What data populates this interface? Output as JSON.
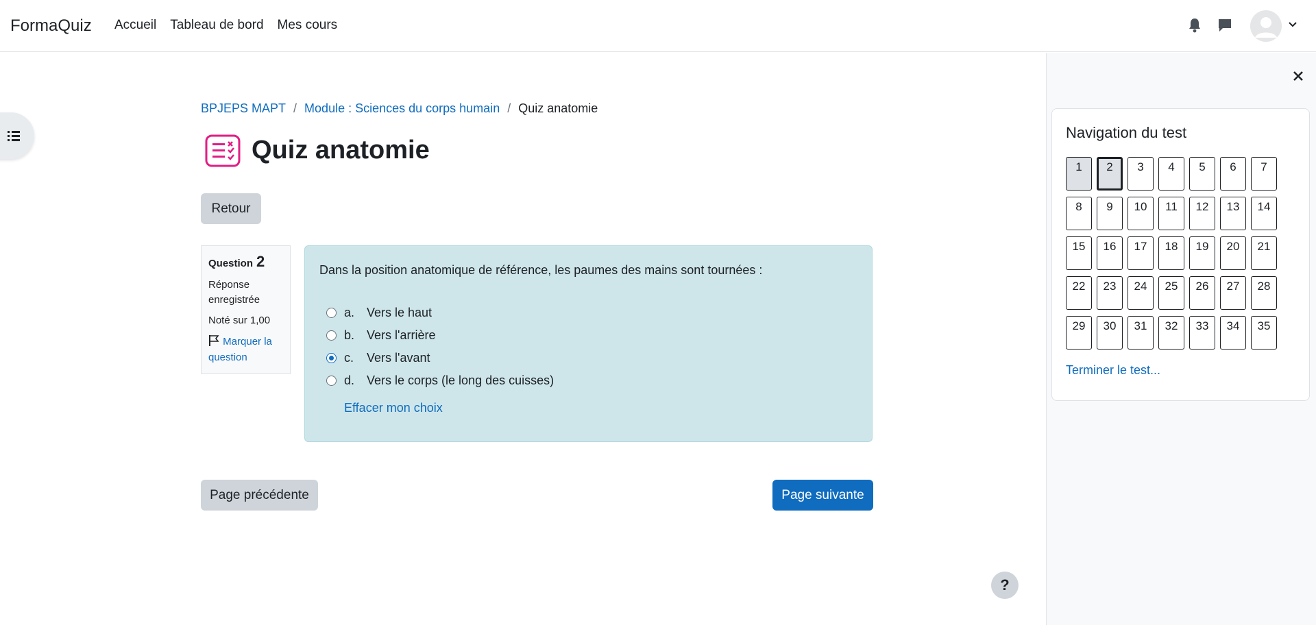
{
  "navbar": {
    "brand": "FormaQuiz",
    "links": [
      "Accueil",
      "Tableau de bord",
      "Mes cours"
    ],
    "icons": [
      "bell-icon",
      "chat-icon",
      "avatar",
      "chevron-down-icon"
    ]
  },
  "breadcrumb": {
    "items": [
      "BPJEPS MAPT",
      "Module : Sciences du corps humain"
    ],
    "current": "Quiz anatomie",
    "separator": "/"
  },
  "page": {
    "title": "Quiz anatomie",
    "back_label": "Retour",
    "prev_label": "Page précédente",
    "next_label": "Page suivante",
    "help_label": "?"
  },
  "question_info": {
    "label": "Question",
    "number": "2",
    "state": "Réponse enregistrée",
    "grade": "Noté sur 1,00",
    "flag_label": "Marquer la question"
  },
  "question": {
    "text": "Dans la position anatomique de référence, les paumes des mains sont tournées :",
    "answers": [
      {
        "letter": "a.",
        "text": "Vers le haut",
        "checked": false
      },
      {
        "letter": "b.",
        "text": "Vers l'arrière",
        "checked": false
      },
      {
        "letter": "c.",
        "text": "Vers l'avant",
        "checked": true
      },
      {
        "letter": "d.",
        "text": "Vers le corps (le long des cuisses)",
        "checked": false
      }
    ],
    "clear_label": "Effacer mon choix"
  },
  "quiz_nav": {
    "title": "Navigation du test",
    "buttons": [
      "1",
      "2",
      "3",
      "4",
      "5",
      "6",
      "7",
      "8",
      "9",
      "10",
      "11",
      "12",
      "13",
      "14",
      "15",
      "16",
      "17",
      "18",
      "19",
      "20",
      "21",
      "22",
      "23",
      "24",
      "25",
      "26",
      "27",
      "28",
      "29",
      "30",
      "31",
      "32",
      "33",
      "34",
      "35"
    ],
    "answered": [
      "1",
      "2"
    ],
    "current": "2",
    "finish_label": "Terminer le test..."
  },
  "colors": {
    "primary": "#0f6cbf",
    "question_bg": "#cee6ea",
    "title_icon": "#e01e84"
  }
}
